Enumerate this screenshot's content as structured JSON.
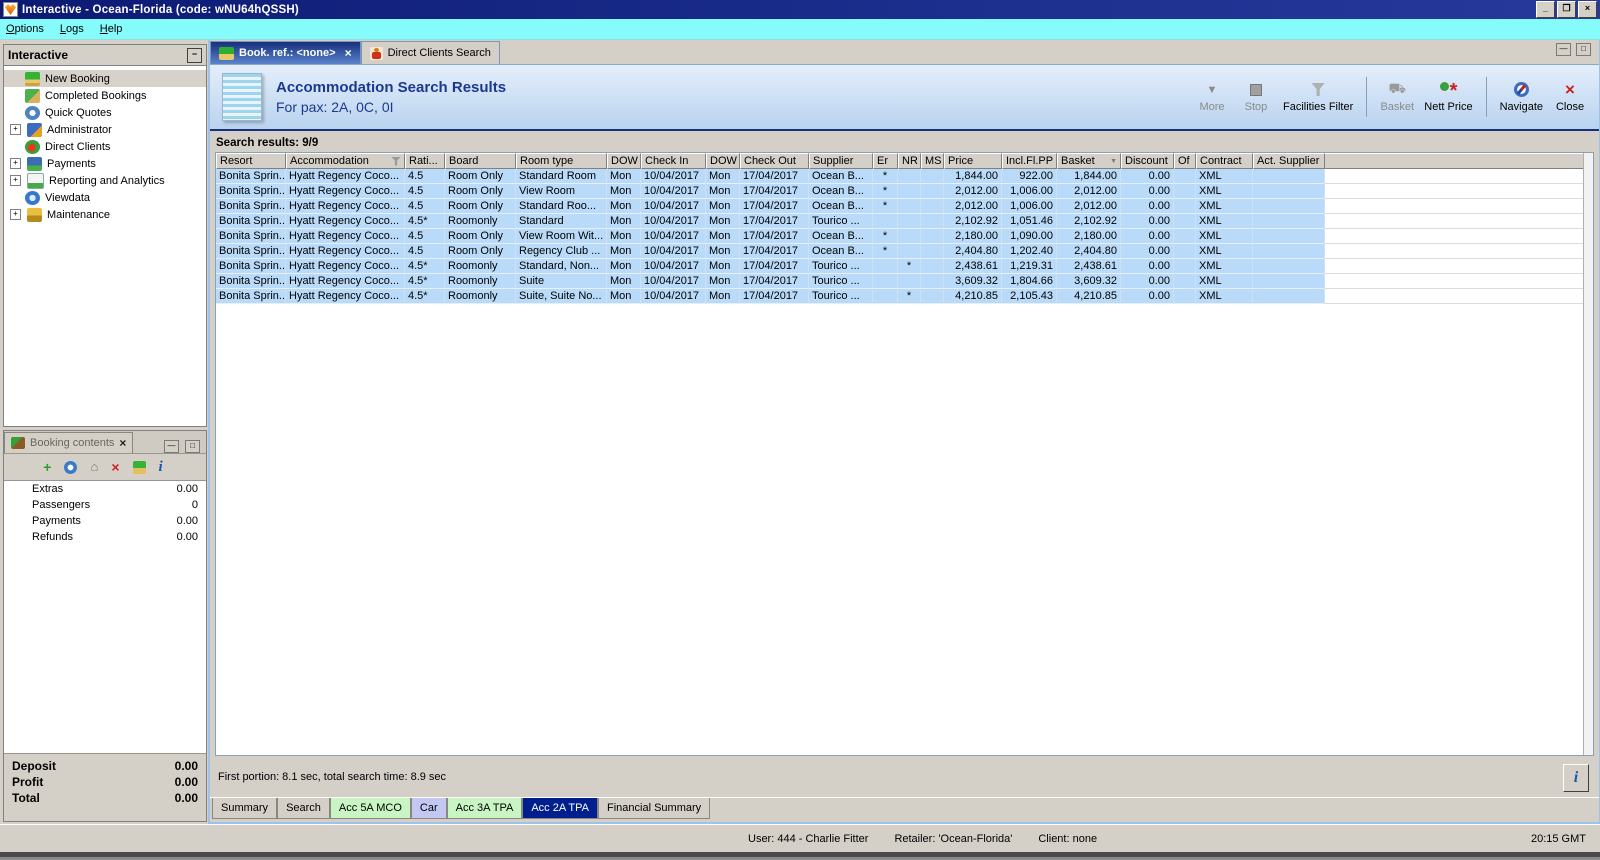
{
  "window": {
    "title": "Interactive - Ocean-Florida (code: wNU64hQSSH)",
    "menu": [
      "Options",
      "Logs",
      "Help"
    ],
    "controls": {
      "minimize": "_",
      "restore": "❐",
      "close": "×"
    }
  },
  "statusbar": {
    "user": "User: 444 - Charlie Fitter",
    "retailer": "Retailer: 'Ocean-Florida'",
    "client": "Client: none",
    "time": "20:15 GMT"
  },
  "sidebar": {
    "title": "Interactive",
    "items": [
      {
        "label": "New Booking",
        "icon": "palm",
        "expandable": false,
        "selected": true
      },
      {
        "label": "Completed Bookings",
        "icon": "money-palm",
        "expandable": false,
        "selected": false
      },
      {
        "label": "Quick Quotes",
        "icon": "clock",
        "expandable": false,
        "selected": false
      },
      {
        "label": "Administrator",
        "icon": "runner",
        "expandable": true,
        "selected": false
      },
      {
        "label": "Direct Clients",
        "icon": "globe-person",
        "expandable": false,
        "selected": false
      },
      {
        "label": "Payments",
        "icon": "payments",
        "expandable": true,
        "selected": false
      },
      {
        "label": "Reporting and Analytics",
        "icon": "report",
        "expandable": true,
        "selected": false
      },
      {
        "label": "Viewdata",
        "icon": "viewdata",
        "expandable": false,
        "selected": false
      },
      {
        "label": "Maintenance",
        "icon": "toolbox",
        "expandable": true,
        "selected": false
      }
    ]
  },
  "booking_contents": {
    "tab_label": "Booking contents",
    "toolbar_icons": [
      "add",
      "quick-quote",
      "basket-move",
      "delete",
      "palm",
      "info"
    ],
    "rows": [
      {
        "label": "Extras",
        "value": "0.00"
      },
      {
        "label": "Passengers",
        "value": "0"
      },
      {
        "label": "Payments",
        "value": "0.00"
      },
      {
        "label": "Refunds",
        "value": "0.00"
      }
    ],
    "summary": [
      {
        "label": "Deposit",
        "value": "0.00"
      },
      {
        "label": "Profit",
        "value": "0.00"
      },
      {
        "label": "Total",
        "value": "0.00"
      }
    ]
  },
  "main": {
    "tabs": [
      {
        "label": "Book. ref.: <none>",
        "icon": "palm",
        "selected": true,
        "closable": true
      },
      {
        "label": "Direct Clients Search",
        "icon": "person",
        "selected": false,
        "closable": false
      }
    ],
    "header": {
      "title": "Accommodation Search Results",
      "subtitle": "For pax: 2A, 0C, 0I"
    },
    "toolbar": [
      {
        "label": "More",
        "icon": "more",
        "disabled": true
      },
      {
        "label": "Stop",
        "icon": "stop",
        "disabled": true
      },
      {
        "label": "Facilities Filter",
        "icon": "filter",
        "disabled": false
      },
      {
        "separator": true
      },
      {
        "label": "Basket",
        "icon": "basket",
        "disabled": true
      },
      {
        "label": "Nett Price",
        "icon": "nett-price",
        "disabled": false
      },
      {
        "separator": true
      },
      {
        "label": "Navigate",
        "icon": "navigate",
        "disabled": false
      },
      {
        "label": "Close",
        "icon": "close",
        "disabled": false
      }
    ],
    "results_label": "Search results: 9/9",
    "table": {
      "columns": [
        "Resort",
        "Accommodation",
        "Rati...",
        "Board",
        "Room type",
        "DOW",
        "Check In",
        "DOW",
        "Check Out",
        "Supplier",
        "Er",
        "NR",
        "MS",
        "Price",
        "Incl.Fl.PP",
        "Basket",
        "Discount",
        "Of",
        "Contract",
        "Act. Supplier"
      ],
      "filter_column": "Accommodation",
      "sort_column": "Basket",
      "rows": [
        [
          "Bonita Sprin...",
          "Hyatt Regency Coco...",
          "4.5",
          "Room Only",
          "Standard Room",
          "Mon",
          "10/04/2017",
          "Mon",
          "17/04/2017",
          "Ocean B...",
          "*",
          "",
          "",
          "1,844.00",
          "922.00",
          "1,844.00",
          "0.00",
          "",
          "XML",
          ""
        ],
        [
          "Bonita Sprin...",
          "Hyatt Regency Coco...",
          "4.5",
          "Room Only",
          "View Room",
          "Mon",
          "10/04/2017",
          "Mon",
          "17/04/2017",
          "Ocean B...",
          "*",
          "",
          "",
          "2,012.00",
          "1,006.00",
          "2,012.00",
          "0.00",
          "",
          "XML",
          ""
        ],
        [
          "Bonita Sprin...",
          "Hyatt Regency Coco...",
          "4.5",
          "Room Only",
          "Standard Roo...",
          "Mon",
          "10/04/2017",
          "Mon",
          "17/04/2017",
          "Ocean B...",
          "*",
          "",
          "",
          "2,012.00",
          "1,006.00",
          "2,012.00",
          "0.00",
          "",
          "XML",
          ""
        ],
        [
          "Bonita Sprin...",
          "Hyatt Regency Coco...",
          "4.5*",
          "Roomonly",
          "Standard",
          "Mon",
          "10/04/2017",
          "Mon",
          "17/04/2017",
          "Tourico ...",
          "",
          "",
          "",
          "2,102.92",
          "1,051.46",
          "2,102.92",
          "0.00",
          "",
          "XML",
          ""
        ],
        [
          "Bonita Sprin...",
          "Hyatt Regency Coco...",
          "4.5",
          "Room Only",
          "View Room Wit...",
          "Mon",
          "10/04/2017",
          "Mon",
          "17/04/2017",
          "Ocean B...",
          "*",
          "",
          "",
          "2,180.00",
          "1,090.00",
          "2,180.00",
          "0.00",
          "",
          "XML",
          ""
        ],
        [
          "Bonita Sprin...",
          "Hyatt Regency Coco...",
          "4.5",
          "Room Only",
          "Regency Club ...",
          "Mon",
          "10/04/2017",
          "Mon",
          "17/04/2017",
          "Ocean B...",
          "*",
          "",
          "",
          "2,404.80",
          "1,202.40",
          "2,404.80",
          "0.00",
          "",
          "XML",
          ""
        ],
        [
          "Bonita Sprin...",
          "Hyatt Regency Coco...",
          "4.5*",
          "Roomonly",
          "Standard, Non...",
          "Mon",
          "10/04/2017",
          "Mon",
          "17/04/2017",
          "Tourico ...",
          "",
          "*",
          "",
          "2,438.61",
          "1,219.31",
          "2,438.61",
          "0.00",
          "",
          "XML",
          ""
        ],
        [
          "Bonita Sprin...",
          "Hyatt Regency Coco...",
          "4.5*",
          "Roomonly",
          "Suite",
          "Mon",
          "10/04/2017",
          "Mon",
          "17/04/2017",
          "Tourico ...",
          "",
          "",
          "",
          "3,609.32",
          "1,804.66",
          "3,609.32",
          "0.00",
          "",
          "XML",
          ""
        ],
        [
          "Bonita Sprin...",
          "Hyatt Regency Coco...",
          "4.5*",
          "Roomonly",
          "Suite, Suite No...",
          "Mon",
          "10/04/2017",
          "Mon",
          "17/04/2017",
          "Tourico ...",
          "",
          "*",
          "",
          "4,210.85",
          "2,105.43",
          "4,210.85",
          "0.00",
          "",
          "XML",
          ""
        ]
      ]
    },
    "status_text": "First portion: 8.1 sec, total search time: 8.9 sec",
    "bottom_tabs": [
      {
        "label": "Summary",
        "color": "plain",
        "selected": false
      },
      {
        "label": "Search",
        "color": "plain",
        "selected": false
      },
      {
        "label": "Acc 5A MCO",
        "color": "green",
        "selected": false
      },
      {
        "label": "Car",
        "color": "lavender",
        "selected": false
      },
      {
        "label": "Acc 3A TPA",
        "color": "green",
        "selected": false
      },
      {
        "label": "Acc 2A TPA",
        "color": "navy",
        "selected": true
      },
      {
        "label": "Financial Summary",
        "color": "plain",
        "selected": false
      }
    ]
  },
  "colors": {
    "titlebar": "#0c1a74",
    "menubar": "#86fbfc",
    "row_blue": "#b9dbf9",
    "selected_tab_navy": "#001f8e",
    "header_text_navy": "#1c3a8c"
  }
}
